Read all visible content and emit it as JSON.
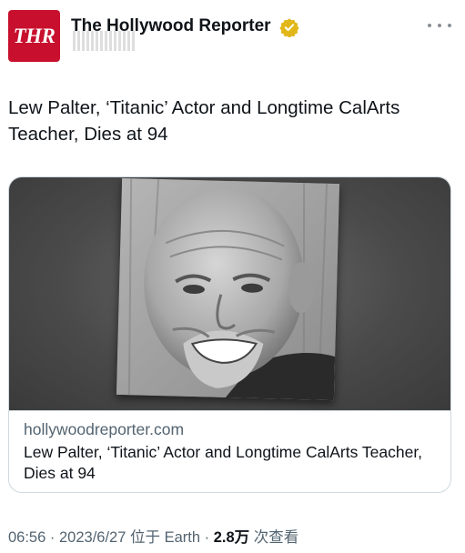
{
  "account": {
    "avatar_text": "THR",
    "name": "The Hollywood Reporter",
    "verified_icon": "verified-gold-badge-icon",
    "more_icon": "more-dots-icon"
  },
  "tweet": {
    "text": "Lew Palter, ‘Titanic’ Actor and Longtime CalArts Teacher, Dies at 94"
  },
  "card": {
    "domain": "hollywoodreporter.com",
    "title": "Lew Palter, ‘Titanic’ Actor and Longtime CalArts Teacher, Dies at 94"
  },
  "meta": {
    "time": "06:56",
    "date": "2023/6/27",
    "location": "位于 Earth",
    "views_count": "2.8万",
    "views_label": "次查看"
  },
  "colors": {
    "avatar_bg": "#c8102e",
    "verified_gold": "#e2b719",
    "text": "#0f1419",
    "secondary": "#536471"
  }
}
